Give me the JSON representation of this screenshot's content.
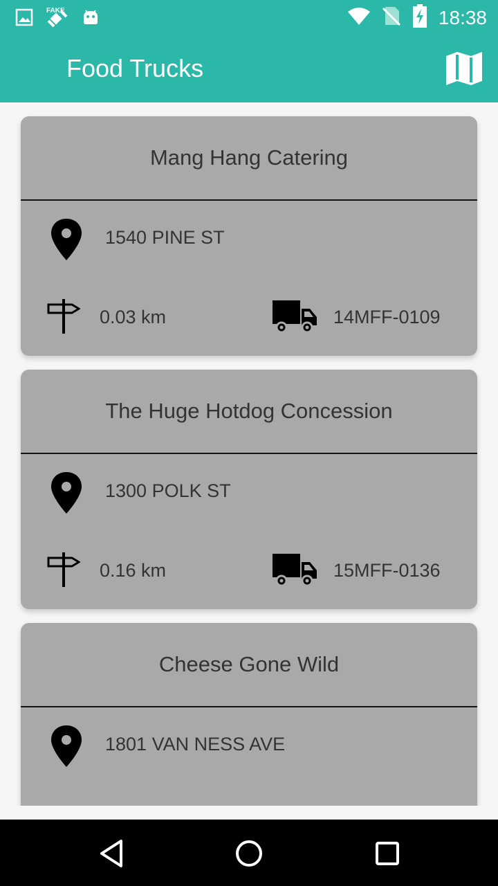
{
  "status_bar": {
    "time": "18:38",
    "icons": [
      "image-icon",
      "fake-gps-icon",
      "android-icon",
      "wifi-icon",
      "no-sim-icon",
      "battery-charging-icon"
    ]
  },
  "app_bar": {
    "title": "Food Trucks",
    "action_icon": "map-icon"
  },
  "trucks": [
    {
      "name": "Mang Hang Catering",
      "address": "1540 PINE ST",
      "distance": "0.03 km",
      "permit": "14MFF-0109"
    },
    {
      "name": "The Huge Hotdog Concession",
      "address": "1300 POLK ST",
      "distance": "0.16 km",
      "permit": "15MFF-0136"
    },
    {
      "name": "Cheese Gone Wild",
      "address": "1801 VAN NESS AVE"
    }
  ],
  "nav_bar": {
    "icons": [
      "back-icon",
      "home-icon",
      "recents-icon"
    ]
  },
  "colors": {
    "primary": "#2bb8a8",
    "card": "#a9a9a9",
    "background": "#f6f6f6"
  }
}
